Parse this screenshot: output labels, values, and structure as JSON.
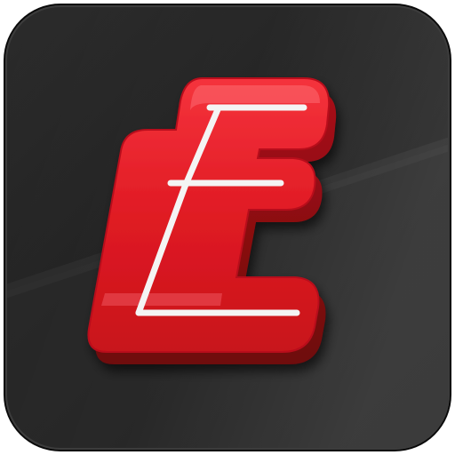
{
  "icon": {
    "name": "app-icon",
    "glyph": "E",
    "colors": {
      "background_dark": "#1a1a1a",
      "background_mid": "#333333",
      "letter_red": "#e8202a",
      "letter_dark_red": "#8e0c12",
      "letter_highlight": "#ff6a6f",
      "stroke_white": "#f2f2f2"
    }
  }
}
